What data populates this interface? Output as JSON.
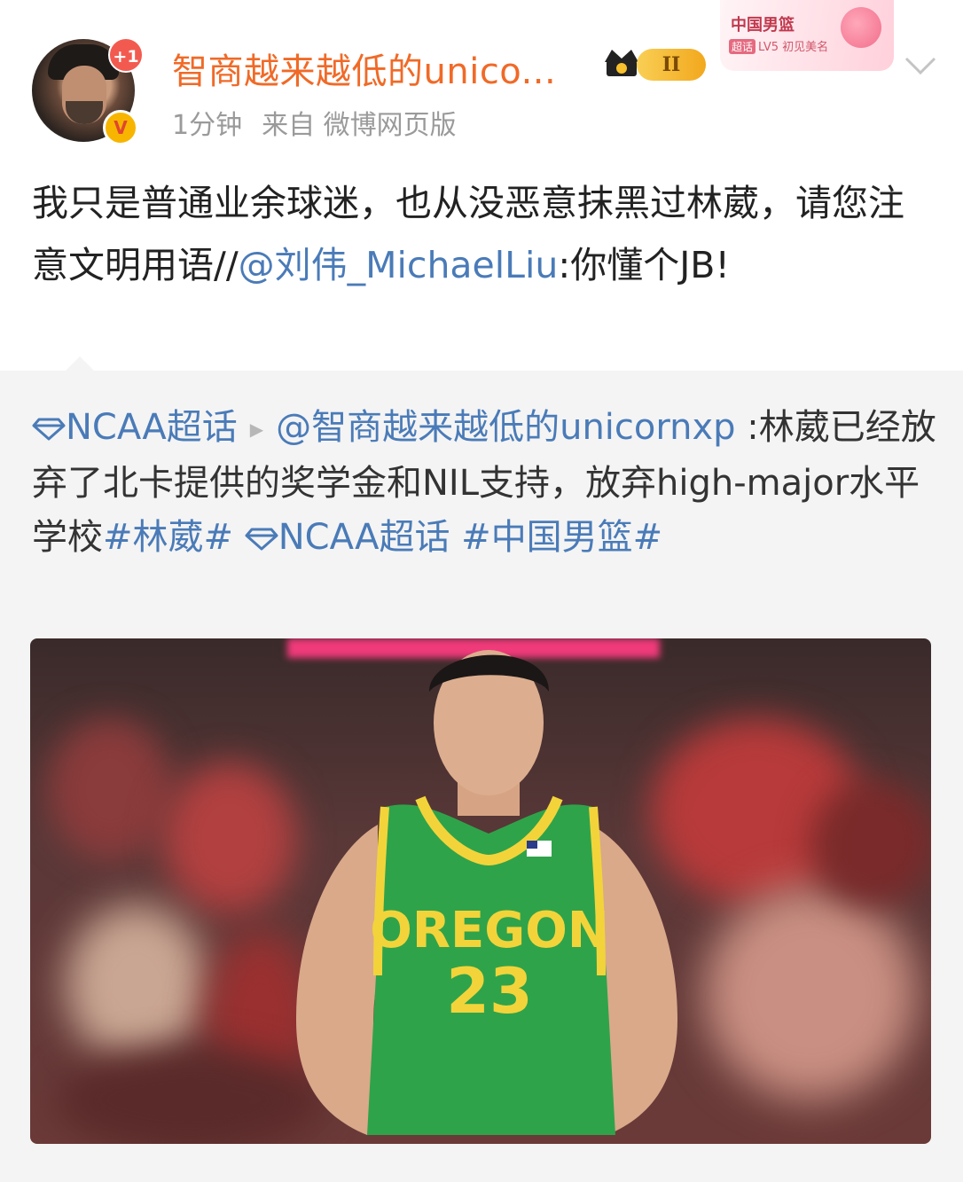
{
  "post": {
    "avatar_badge": "+1",
    "username": "智商越来越低的unico...",
    "vip_level": "II",
    "time": "1分钟",
    "source": "来自 微博网页版",
    "fan_badge": {
      "title": "中国男篮",
      "tag": "超话",
      "level": "LV5 初见美名"
    },
    "text_prefix": "我只是普通业余球迷，也从没恶意抹黑过林葳，请您注意文明用语//",
    "mention": "@刘伟_MichaelLiu",
    "text_suffix": ":你懂个JB!"
  },
  "repost": {
    "topic_1": "NCAA超话",
    "mention": "@智商越来越低的unicornxp",
    "body": " :林葳已经放弃了北卡提供的奖学金和NIL支持，放弃high-major水平学校",
    "hashtag_1": "#林葳#",
    "topic_2": "NCAA超话",
    "hashtag_2": "#中国男篮#"
  },
  "photo": {
    "jersey_team": "OREGON",
    "jersey_number": "23"
  },
  "colors": {
    "username": "#f06a27",
    "link": "#4a7bb8",
    "repost_bg": "#f4f4f4",
    "jersey": "#2fa34a",
    "jersey_trim": "#f2d43a"
  },
  "icons": [
    "verified-icon",
    "crown-icon",
    "chevron-down-icon",
    "diamond-topic-icon",
    "triangle-right-icon"
  ]
}
